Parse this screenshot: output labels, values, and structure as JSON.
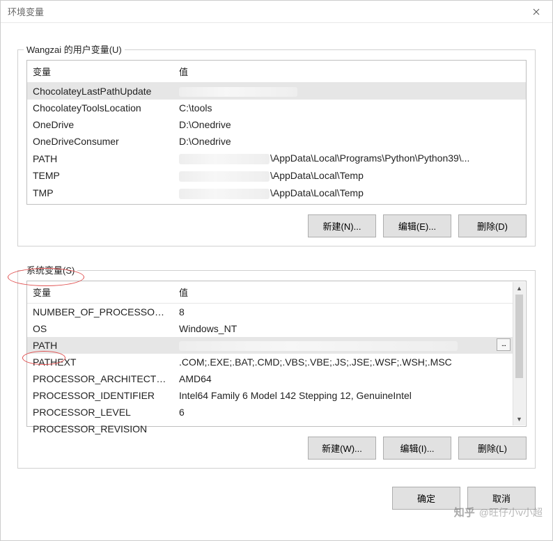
{
  "window": {
    "title": "环境变量"
  },
  "user_vars": {
    "group_label": "Wangzai 的用户变量(U)",
    "columns": {
      "var": "变量",
      "val": "值"
    },
    "rows": [
      {
        "var": "ChocolateyLastPathUpdate",
        "val": ""
      },
      {
        "var": "ChocolateyToolsLocation",
        "val": "C:\\tools"
      },
      {
        "var": "OneDrive",
        "val": "D:\\Onedrive"
      },
      {
        "var": "OneDriveConsumer",
        "val": "D:\\Onedrive"
      },
      {
        "var": "PATH",
        "val": "\\AppData\\Local\\Programs\\Python\\Python39\\..."
      },
      {
        "var": "TEMP",
        "val": "\\AppData\\Local\\Temp"
      },
      {
        "var": "TMP",
        "val": "\\AppData\\Local\\Temp"
      }
    ],
    "buttons": {
      "new": "新建(N)...",
      "edit": "编辑(E)...",
      "delete": "删除(D)"
    }
  },
  "system_vars": {
    "group_label": "系统变量(S)",
    "columns": {
      "var": "变量",
      "val": "值"
    },
    "rows": [
      {
        "var": "NUMBER_OF_PROCESSORS",
        "val": "8"
      },
      {
        "var": "OS",
        "val": "Windows_NT"
      },
      {
        "var": "PATH",
        "val": ""
      },
      {
        "var": "PATHEXT",
        "val": ".COM;.EXE;.BAT;.CMD;.VBS;.VBE;.JS;.JSE;.WSF;.WSH;.MSC"
      },
      {
        "var": "PROCESSOR_ARCHITECTURE",
        "val": "AMD64"
      },
      {
        "var": "PROCESSOR_IDENTIFIER",
        "val": "Intel64 Family 6 Model 142 Stepping 12, GenuineIntel"
      },
      {
        "var": "PROCESSOR_LEVEL",
        "val": "6"
      },
      {
        "var": "PROCESSOR_REVISION",
        "val": ""
      }
    ],
    "buttons": {
      "new": "新建(W)...",
      "edit": "编辑(I)...",
      "delete": "删除(L)"
    }
  },
  "footer": {
    "ok": "确定",
    "cancel": "取消"
  },
  "watermark": {
    "logo": "知乎",
    "text": "@旺仔小v小超"
  }
}
